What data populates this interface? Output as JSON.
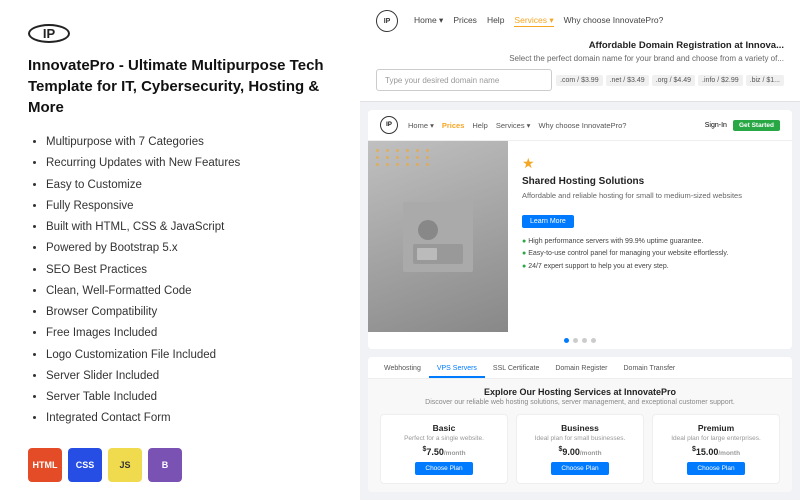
{
  "left": {
    "logo_text": "IP",
    "title": "InnovatePro - Ultimate Multipurpose Tech Template for IT, Cybersecurity, Hosting & More",
    "features": [
      "Multipurpose with 7 Categories",
      "Recurring Updates with New Features",
      "Easy to Customize",
      "Fully Responsive",
      "Built with HTML, CSS & JavaScript",
      "Powered by Bootstrap 5.x",
      "SEO Best Practices",
      "Clean, Well-Formatted Code",
      "Browser Compatibility",
      "Free Images Included",
      "Logo Customization File Included",
      "Server Slider Included",
      "Server Table Included",
      "Integrated Contact Form"
    ],
    "tech_icons": [
      {
        "label": "HTML",
        "class": "tech-html"
      },
      {
        "label": "CSS",
        "class": "tech-css"
      },
      {
        "label": "JS",
        "class": "tech-js"
      },
      {
        "label": "B",
        "class": "tech-bs"
      }
    ]
  },
  "right": {
    "top_nav": {
      "logo": "IP",
      "links": [
        "Home ▾",
        "Prices",
        "Help",
        "Services ▾",
        "Why choose InnovatePro?"
      ],
      "active_link": "Services ▾"
    },
    "domain_section": {
      "title": "Affordable Domain Registration at Innova...",
      "subtitle": "Select the perfect domain name for your brand and choose from a variety of...",
      "search_placeholder": "Type your desired domain name",
      "tlds": [
        ".com / $3.99",
        ".net / $3.49",
        ".org / $4.49",
        ".info / $2.99",
        ".biz / $1..."
      ]
    },
    "mid_nav": {
      "logo": "IP",
      "links": [
        "Home ▾",
        "Prices",
        "Help",
        "Services ▾",
        "Why choose InnovatePro?"
      ],
      "prices_active": true,
      "sign_in": "Sign-In",
      "get_started": "Get Started"
    },
    "hosting": {
      "star": "★",
      "title": "Shared Hosting Solutions",
      "description": "Affordable and reliable hosting for small to medium-sized websites",
      "cta": "Learn More",
      "features": [
        "High performance servers with 99.9% uptime guarantee.",
        "Easy-to-use control panel for managing your website effortlessly.",
        "24/7 expert support to help you at every step."
      ]
    },
    "tabs": [
      "Webhosting",
      "VPS Servers",
      "SSL Certificate",
      "Domain Register",
      "Domain Transfer"
    ],
    "active_tab": "VPS Servers",
    "pricing": {
      "title": "Explore Our Hosting Services at InnovatePro",
      "subtitle": "Discover our reliable web hosting solutions, server management, and exceptional customer support.",
      "cards": [
        {
          "name": "Basic",
          "tagline": "Perfect for a single website.",
          "price": "7.50",
          "month": "/month",
          "btn": "Choose Plan"
        },
        {
          "name": "Business",
          "tagline": "Ideal plan for small businesses.",
          "price": "9.00",
          "month": "/month",
          "btn": "Choose Plan"
        },
        {
          "name": "Premium",
          "tagline": "Ideal plan for large enterprises.",
          "price": "15.00",
          "month": "/month",
          "btn": "Choose Plan"
        }
      ]
    }
  }
}
